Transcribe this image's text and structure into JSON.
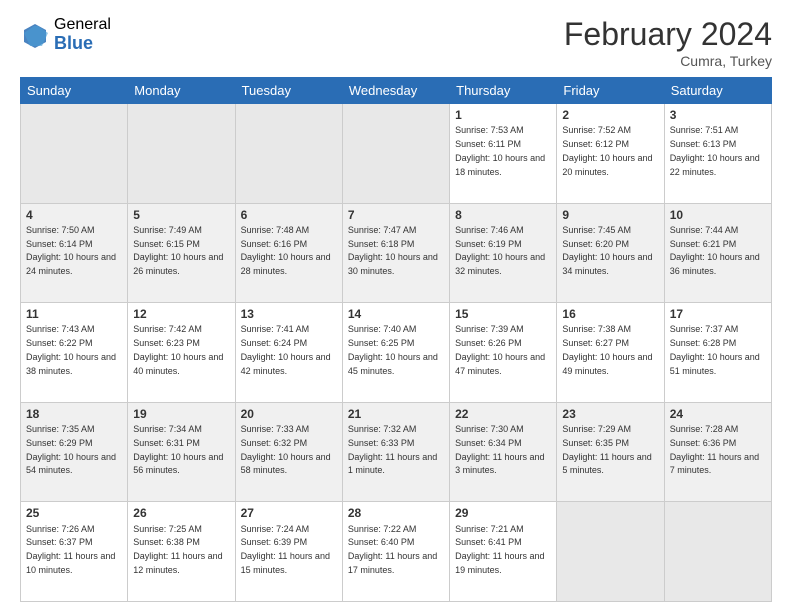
{
  "logo": {
    "general": "General",
    "blue": "Blue"
  },
  "title": "February 2024",
  "subtitle": "Cumra, Turkey",
  "days_of_week": [
    "Sunday",
    "Monday",
    "Tuesday",
    "Wednesday",
    "Thursday",
    "Friday",
    "Saturday"
  ],
  "weeks": [
    [
      {
        "day": "",
        "info": "",
        "empty": true
      },
      {
        "day": "",
        "info": "",
        "empty": true
      },
      {
        "day": "",
        "info": "",
        "empty": true
      },
      {
        "day": "",
        "info": "",
        "empty": true
      },
      {
        "day": "1",
        "sunrise": "7:53 AM",
        "sunset": "6:11 PM",
        "daylight": "10 hours and 18 minutes."
      },
      {
        "day": "2",
        "sunrise": "7:52 AM",
        "sunset": "6:12 PM",
        "daylight": "10 hours and 20 minutes."
      },
      {
        "day": "3",
        "sunrise": "7:51 AM",
        "sunset": "6:13 PM",
        "daylight": "10 hours and 22 minutes."
      }
    ],
    [
      {
        "day": "4",
        "sunrise": "7:50 AM",
        "sunset": "6:14 PM",
        "daylight": "10 hours and 24 minutes."
      },
      {
        "day": "5",
        "sunrise": "7:49 AM",
        "sunset": "6:15 PM",
        "daylight": "10 hours and 26 minutes."
      },
      {
        "day": "6",
        "sunrise": "7:48 AM",
        "sunset": "6:16 PM",
        "daylight": "10 hours and 28 minutes."
      },
      {
        "day": "7",
        "sunrise": "7:47 AM",
        "sunset": "6:18 PM",
        "daylight": "10 hours and 30 minutes."
      },
      {
        "day": "8",
        "sunrise": "7:46 AM",
        "sunset": "6:19 PM",
        "daylight": "10 hours and 32 minutes."
      },
      {
        "day": "9",
        "sunrise": "7:45 AM",
        "sunset": "6:20 PM",
        "daylight": "10 hours and 34 minutes."
      },
      {
        "day": "10",
        "sunrise": "7:44 AM",
        "sunset": "6:21 PM",
        "daylight": "10 hours and 36 minutes."
      }
    ],
    [
      {
        "day": "11",
        "sunrise": "7:43 AM",
        "sunset": "6:22 PM",
        "daylight": "10 hours and 38 minutes."
      },
      {
        "day": "12",
        "sunrise": "7:42 AM",
        "sunset": "6:23 PM",
        "daylight": "10 hours and 40 minutes."
      },
      {
        "day": "13",
        "sunrise": "7:41 AM",
        "sunset": "6:24 PM",
        "daylight": "10 hours and 42 minutes."
      },
      {
        "day": "14",
        "sunrise": "7:40 AM",
        "sunset": "6:25 PM",
        "daylight": "10 hours and 45 minutes."
      },
      {
        "day": "15",
        "sunrise": "7:39 AM",
        "sunset": "6:26 PM",
        "daylight": "10 hours and 47 minutes."
      },
      {
        "day": "16",
        "sunrise": "7:38 AM",
        "sunset": "6:27 PM",
        "daylight": "10 hours and 49 minutes."
      },
      {
        "day": "17",
        "sunrise": "7:37 AM",
        "sunset": "6:28 PM",
        "daylight": "10 hours and 51 minutes."
      }
    ],
    [
      {
        "day": "18",
        "sunrise": "7:35 AM",
        "sunset": "6:29 PM",
        "daylight": "10 hours and 54 minutes."
      },
      {
        "day": "19",
        "sunrise": "7:34 AM",
        "sunset": "6:31 PM",
        "daylight": "10 hours and 56 minutes."
      },
      {
        "day": "20",
        "sunrise": "7:33 AM",
        "sunset": "6:32 PM",
        "daylight": "10 hours and 58 minutes."
      },
      {
        "day": "21",
        "sunrise": "7:32 AM",
        "sunset": "6:33 PM",
        "daylight": "11 hours and 1 minute."
      },
      {
        "day": "22",
        "sunrise": "7:30 AM",
        "sunset": "6:34 PM",
        "daylight": "11 hours and 3 minutes."
      },
      {
        "day": "23",
        "sunrise": "7:29 AM",
        "sunset": "6:35 PM",
        "daylight": "11 hours and 5 minutes."
      },
      {
        "day": "24",
        "sunrise": "7:28 AM",
        "sunset": "6:36 PM",
        "daylight": "11 hours and 7 minutes."
      }
    ],
    [
      {
        "day": "25",
        "sunrise": "7:26 AM",
        "sunset": "6:37 PM",
        "daylight": "11 hours and 10 minutes."
      },
      {
        "day": "26",
        "sunrise": "7:25 AM",
        "sunset": "6:38 PM",
        "daylight": "11 hours and 12 minutes."
      },
      {
        "day": "27",
        "sunrise": "7:24 AM",
        "sunset": "6:39 PM",
        "daylight": "11 hours and 15 minutes."
      },
      {
        "day": "28",
        "sunrise": "7:22 AM",
        "sunset": "6:40 PM",
        "daylight": "11 hours and 17 minutes."
      },
      {
        "day": "29",
        "sunrise": "7:21 AM",
        "sunset": "6:41 PM",
        "daylight": "11 hours and 19 minutes."
      },
      {
        "day": "",
        "info": "",
        "empty": true
      },
      {
        "day": "",
        "info": "",
        "empty": true
      }
    ]
  ]
}
